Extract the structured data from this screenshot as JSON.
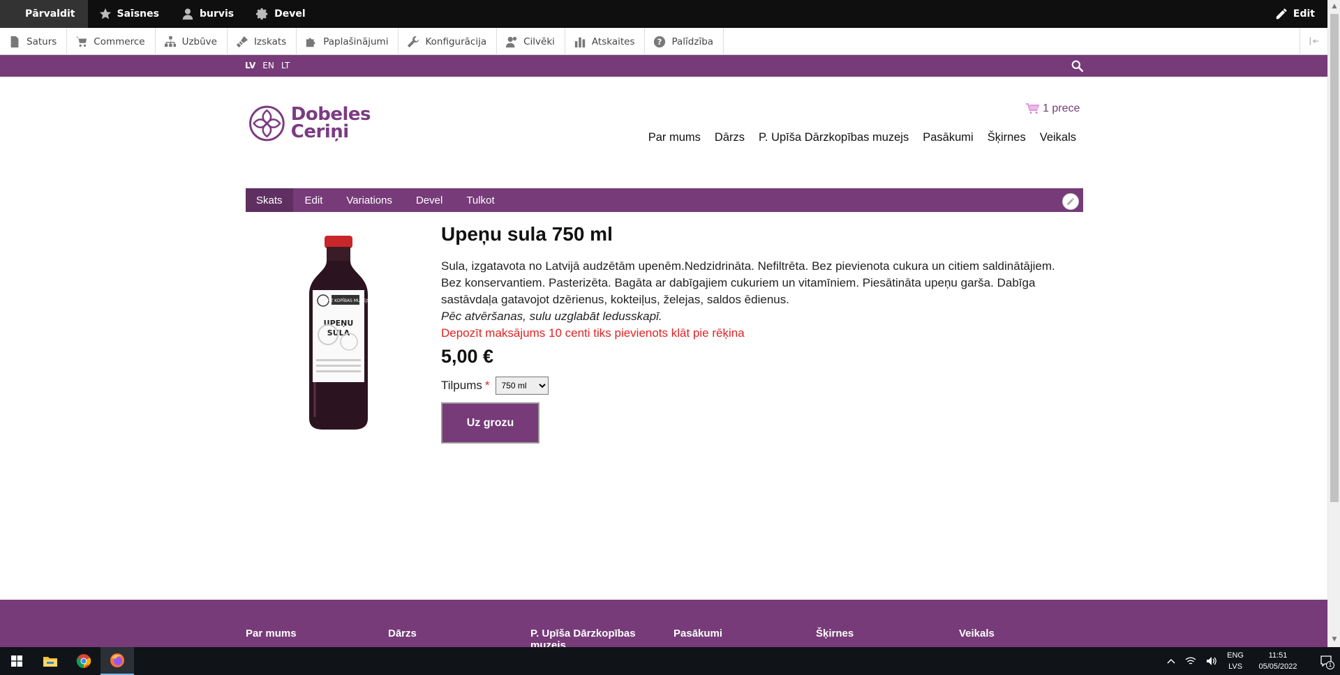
{
  "admin_toolbar": {
    "manage": "Pārvaldit",
    "shortcuts": "Saīsnes",
    "user": "burvis",
    "devel": "Devel",
    "edit": "Edit"
  },
  "admin_tray": {
    "items": [
      "Saturs",
      "Commerce",
      "Uzbūve",
      "Izskats",
      "Paplašinājumi",
      "Konfigurācija",
      "Cilvēki",
      "Atskaites",
      "Palīdzība"
    ]
  },
  "languages": {
    "items": [
      "LV",
      "EN",
      "LT"
    ],
    "active": "LV"
  },
  "header": {
    "logo_line1": "Dobeles",
    "logo_line2": "Ceriņi",
    "cart_label": "1 prece",
    "nav": [
      "Par mums",
      "Dārzs",
      "P. Upīša Dārzkopības muzejs",
      "Pasākumi",
      "Šķirnes",
      "Veikals"
    ]
  },
  "tasks": {
    "items": [
      "Skats",
      "Edit",
      "Variations",
      "Devel",
      "Tulkot"
    ],
    "active": "Skats"
  },
  "product": {
    "title": "Upeņu sula 750 ml",
    "description": "Sula, izgatavota no Latvijā audzētām upenēm.Nedzidrināta. Nefiltrēta. Bez pievienota cukura un citiem saldinātājiem. Bez konservantiem. Pasterizēta. Bagāta ar dabīgajiem cukuriem un vitamīniem. Piesātināta upeņu garša. Dabīga sastāvdaļa gatavojot dzērienus, kokteiļus, želejas, saldos ēdienus.",
    "note": "Pēc atvēršanas, sulu uzglabāt ledusskapī.",
    "deposit": "Depozīt maksājums 10 centi tiks pievienots klāt pie rēķina",
    "price": "5,00 €",
    "variant_label": "Tilpums",
    "variant_required": "*",
    "variant_value": "750 ml",
    "add_to_cart": "Uz grozu",
    "bottle_label_line1": "UPEŅU",
    "bottle_label_line2": "SULA",
    "bottle_brand": "DĀRZ KOPĪBAS MUZEJS"
  },
  "footer": {
    "columns": [
      "Par mums",
      "Dārzs",
      "P. Upīša Dārzkopības muzejs",
      "Pasākumi",
      "Šķirnes",
      "Veikals"
    ]
  },
  "taskbar": {
    "lang_top": "ENG",
    "lang_bottom": "LVS",
    "time": "11:51",
    "date": "05/05/2022",
    "notification_count": "1"
  },
  "colors": {
    "brand_purple": "#763b78",
    "deposit_red": "#e32222"
  }
}
